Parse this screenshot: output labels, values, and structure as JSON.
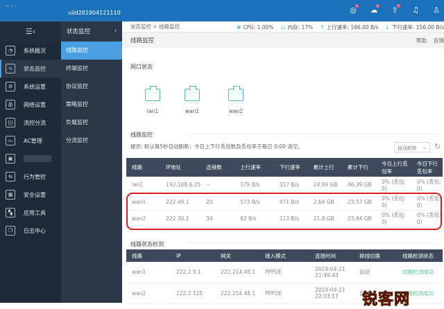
{
  "header": {
    "brand": "-- -   -",
    "device": "uild201904121110",
    "icons": [
      "compass-icon",
      "cloud-icon",
      "upgrade-icon",
      "bell-icon",
      "user-icon"
    ]
  },
  "sidebar": {
    "toggle": "☰‹",
    "items": [
      {
        "label": "系统概况",
        "icon": "dashboard-icon",
        "glyph": "◔"
      },
      {
        "label": "状态监控",
        "icon": "monitor-icon",
        "glyph": "∿"
      },
      {
        "label": "系统设置",
        "icon": "gear-icon",
        "glyph": "⚙"
      },
      {
        "label": "网络设置",
        "icon": "network-icon",
        "glyph": "品"
      },
      {
        "label": "流控分流",
        "icon": "sliders-icon",
        "glyph": "|||"
      },
      {
        "label": "AC管理",
        "icon": "ac-icon",
        "glyph": "▭"
      },
      {
        "label": "",
        "icon": "id-card-icon",
        "glyph": "▣"
      },
      {
        "label": "行为管控",
        "icon": "arrows-icon",
        "glyph": "⇆"
      },
      {
        "label": "安全设置",
        "icon": "firewall-icon",
        "glyph": "▦"
      },
      {
        "label": "应用工具",
        "icon": "apps-icon",
        "glyph": "▚"
      },
      {
        "label": "日志中心",
        "icon": "log-icon",
        "glyph": "❐"
      }
    ]
  },
  "submenu": {
    "title": "状态监控",
    "collapse": "‹",
    "items": [
      "线路监控",
      "终端监控",
      "协议监控",
      "策略监控",
      "负载监控",
      "分流监控"
    ]
  },
  "breadcrumb": "状态监控 > 线路监控",
  "stats": {
    "cpu": "CPU: 1.00%",
    "mem": "内存: 17%",
    "up": "上行速率: 166.00 B/s",
    "down": "下行速率: 156.00 B/s"
  },
  "page": {
    "title": "线路监控",
    "help": "帮助",
    "feedback": "反馈"
  },
  "ports": {
    "title": "网口状态",
    "items": [
      "lan1",
      "wan1",
      "wan2"
    ]
  },
  "monitor": {
    "title": "线路监控",
    "hint": "提示: 默认每5秒自动刷新；今日上下行丢包数及丢包率于每日 0:00 清空。",
    "refresh_select": "自动刷新",
    "columns": [
      "线路",
      "IP地址",
      "连接数",
      "上行速率",
      "下行速率",
      "累计上行",
      "累计下行",
      "今日上行丢包率",
      "今日下行丢包率"
    ],
    "rows": [
      [
        "lan1",
        "192.168.6.25",
        "--",
        "379 B/s",
        "317 B/s",
        "24.99 GB",
        "46.39 GB",
        "0% (丢包: 0)",
        "0% (丢包: 0)"
      ],
      [
        "wan1",
        "222     49.1",
        "20",
        "573 B/s",
        "471 B/s",
        "2.64 GB",
        "23.57 GB",
        "0% (丢包: 0)",
        "0% (丢包: 0)"
      ],
      [
        "wan2",
        "222     30.1",
        "34",
        "82 B/s",
        "113 B/s",
        "21.8 GB",
        "23.84 GB",
        "0% (丢包: 0)",
        "0% (丢包: 0)"
      ]
    ]
  },
  "detect": {
    "title": "线路状态检测",
    "columns": [
      "线路",
      "IP",
      "网关",
      "接入模式",
      "连接时间",
      "掉线切换",
      "线路检测状态"
    ],
    "rows": [
      [
        "wan1",
        "222.2   9.1",
        "222.214.48.1",
        "PPPOE",
        "2019-04-21 21:49:43",
        "自动",
        "线路检测成功"
      ],
      [
        "wan2",
        "222.2   125",
        "222.214.48.1",
        "PPPOE",
        "2019-04-21 22:03:17",
        "自动",
        "线路检测成功"
      ]
    ]
  },
  "watermark": "锐客网",
  "colors": {
    "topbar": "#1b72bb",
    "accent": "#4a9fe0",
    "success": "#54c48c",
    "highlight": "#d21e1e"
  }
}
